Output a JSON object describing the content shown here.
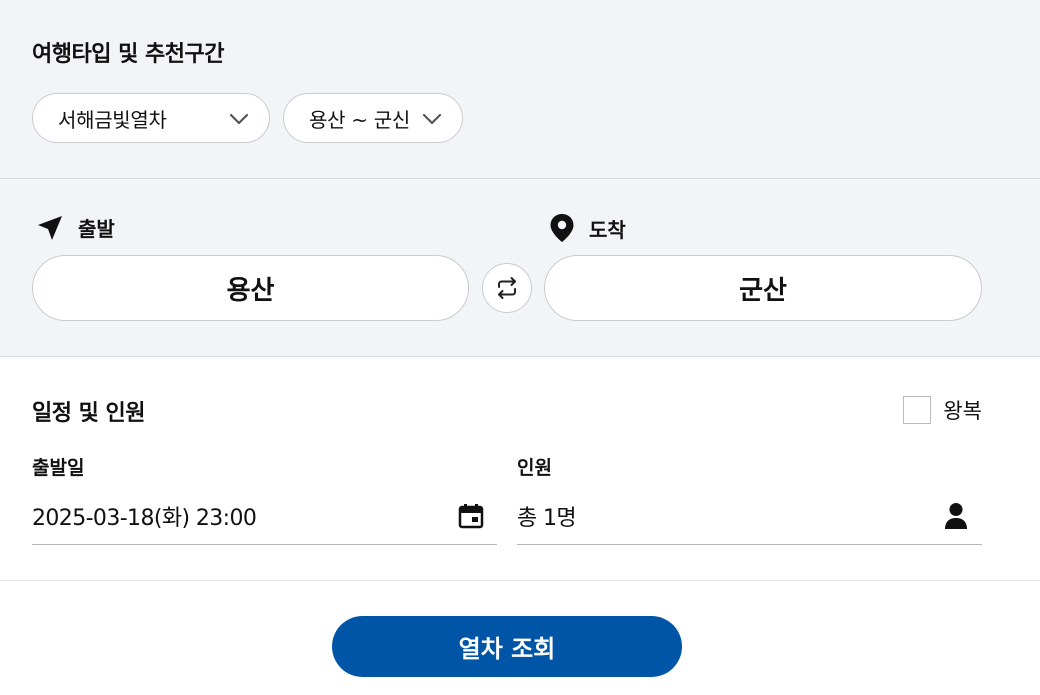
{
  "trip": {
    "title": "여행타입 및 추천구간",
    "type_value": "서해금빛열차",
    "route_value": "용산 ~ 군신"
  },
  "route": {
    "departure_label": "출발",
    "arrival_label": "도착",
    "departure_station": "용산",
    "arrival_station": "군산"
  },
  "schedule": {
    "title": "일정 및 인원",
    "roundtrip_label": "왕복",
    "roundtrip_checked": false,
    "date_label": "출발일",
    "date_value": "2025-03-18(화) 23:00",
    "passenger_label": "인원",
    "passenger_value": "총 1명"
  },
  "action": {
    "search_label": "열차 조회"
  },
  "colors": {
    "background_gray": "#f3f4f7",
    "primary_blue": "#0055a6",
    "border": "#c9cbd1"
  },
  "icons": [
    "chevron-down-icon",
    "navigation-arrow-icon",
    "location-pin-icon",
    "swap-icon",
    "calendar-icon",
    "person-icon"
  ]
}
